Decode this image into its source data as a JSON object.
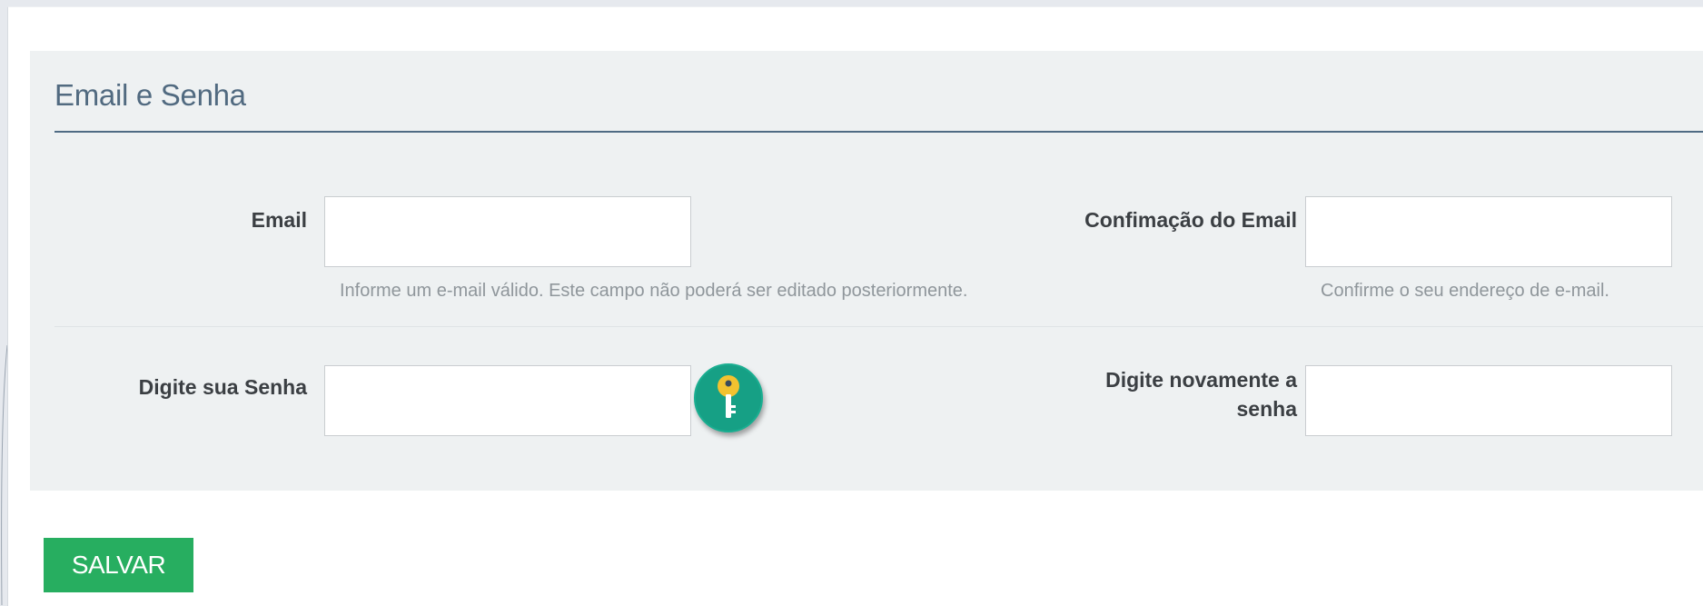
{
  "section": {
    "title": "Email e Senha"
  },
  "fields": {
    "email": {
      "label": "Email",
      "value": "",
      "help": "Informe um e-mail válido. Este campo não poderá ser editado posteriormente."
    },
    "email_confirm": {
      "label": "Confimação do Email",
      "value": "",
      "help": "Confirme o seu endereço de e-mail."
    },
    "password": {
      "label": "Digite sua Senha",
      "value": ""
    },
    "password_confirm": {
      "label_line1": "Digite novamente a",
      "label_line2": "senha",
      "value": ""
    }
  },
  "key_button": {
    "icon": "key-icon"
  },
  "actions": {
    "save_label": "SALVAR"
  },
  "colors": {
    "section_bg": "#eef1f2",
    "title": "#516a80",
    "rule": "#4f6b84",
    "key_button": "#16a085",
    "key": "#f2c230",
    "save_button": "#27ae60"
  }
}
